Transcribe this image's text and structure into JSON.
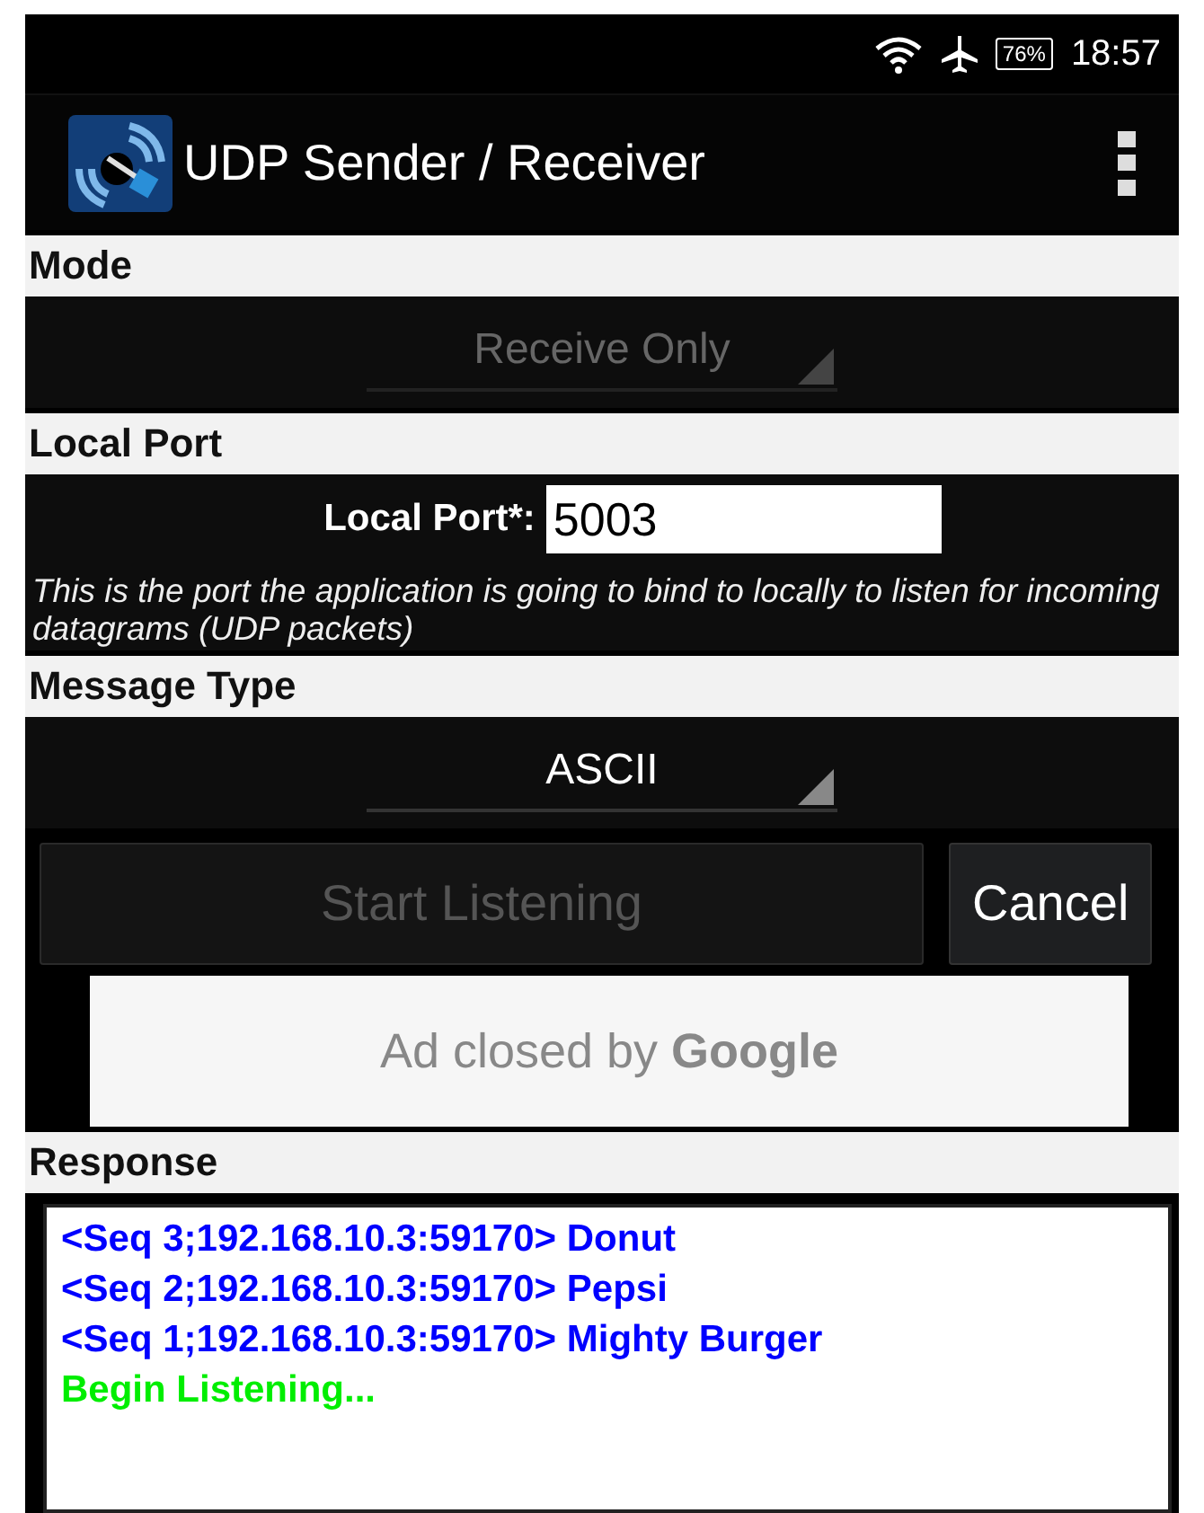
{
  "status_bar": {
    "battery": "76%",
    "time": "18:57"
  },
  "app_bar": {
    "title": "UDP Sender / Receiver"
  },
  "sections": [
    {
      "header": "Mode",
      "kind": "spinner",
      "spinner": {
        "value": "Receive Only",
        "disabled": true
      }
    },
    {
      "header": "Local Port",
      "kind": "port",
      "label": "Local Port*:",
      "value": "5003",
      "hint": "This is the port the application is going to bind to locally to listen for incoming datagrams (UDP packets)"
    },
    {
      "header": "Message Type",
      "kind": "spinner",
      "spinner": {
        "value": "ASCII",
        "disabled": false
      }
    }
  ],
  "buttons": [
    {
      "label": "Start Listening",
      "disabled": true
    },
    {
      "label": "Cancel",
      "disabled": false
    }
  ],
  "ad": {
    "text": "Ad closed by **Google**"
  },
  "response": {
    "header": "Response",
    "lines": [
      {
        "text": "<Seq 3;192.168.10.3:59170> Donut",
        "color": "#0000ff"
      },
      {
        "text": "<Seq 2;192.168.10.3:59170> Pepsi",
        "color": "#0000ff"
      },
      {
        "text": "<Seq 1;192.168.10.3:59170> Mighty Burger",
        "color": "#0000ff"
      },
      {
        "text": "Begin Listening...",
        "color": "#00ee00"
      }
    ]
  }
}
